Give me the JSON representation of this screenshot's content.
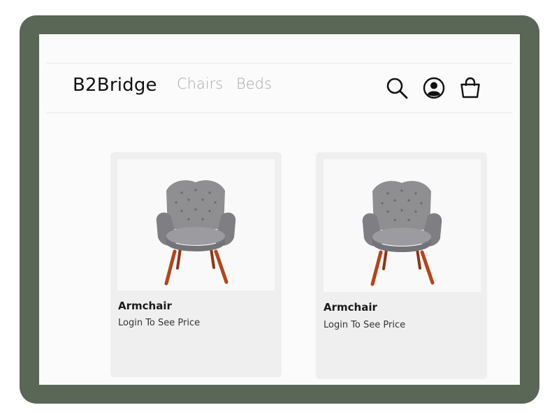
{
  "header": {
    "brand": "B2Bridge",
    "nav": [
      {
        "label": "Chairs"
      },
      {
        "label": "Beds"
      }
    ],
    "icons": [
      "search-icon",
      "account-icon",
      "cart-icon"
    ]
  },
  "products": [
    {
      "title": "Armchair",
      "price_text": "Login To See Price",
      "image": "gray-tufted-armchair"
    },
    {
      "title": "Armchair",
      "price_text": "Login To See Price",
      "image": "gray-tufted-armchair"
    }
  ],
  "colors": {
    "frame": "#5a6656",
    "screen_bg": "#fbfbfb",
    "card_bg": "#efefef",
    "nav_inactive": "#a9a9a9",
    "brand_text": "#111111",
    "chair_fabric": "#8c8c8e",
    "chair_legs": "#b5441c"
  }
}
